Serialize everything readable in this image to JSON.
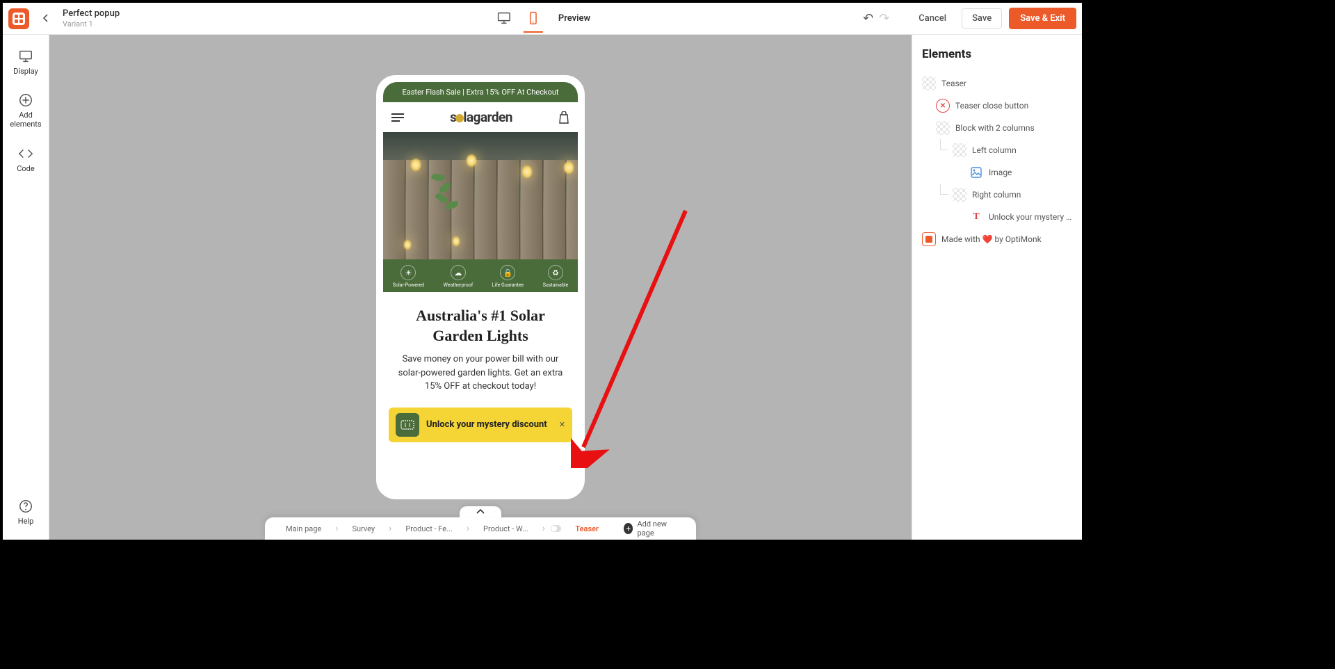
{
  "header": {
    "title": "Perfect popup",
    "subtitle": "Variant 1",
    "preview_label": "Preview",
    "cancel": "Cancel",
    "save": "Save",
    "save_exit": "Save & Exit"
  },
  "sidebar": {
    "display": "Display",
    "add_elements": "Add elements",
    "code": "Code",
    "help": "Help"
  },
  "canvas": {
    "banner": "Easter Flash Sale | Extra 15% OFF At Checkout",
    "site_logo_pre": "s",
    "site_logo_post": "lagarden",
    "features": {
      "f1": "Solar-Powered",
      "f2": "Weatherproof",
      "f3": "Life Guarantee",
      "f4": "Sustainable"
    },
    "headline": "Australia's #1 Solar Garden Lights",
    "body": "Save money on your power bill with our solar-powered garden lights. Get an extra 15% OFF at checkout today!",
    "teaser_text": "Unlock your mystery discount"
  },
  "elements": {
    "title": "Elements",
    "teaser": "Teaser",
    "close_btn": "Teaser close button",
    "block2": "Block with 2 columns",
    "left_col": "Left column",
    "image": "Image",
    "right_col": "Right column",
    "unlock": "Unlock your mystery ...",
    "made": "Made with ❤️ by OptiMonk"
  },
  "pages": {
    "p1": "Main page",
    "p2": "Survey",
    "p3": "Product - Fe...",
    "p4": "Product - W...",
    "p5": "Teaser",
    "add": "Add new page"
  }
}
